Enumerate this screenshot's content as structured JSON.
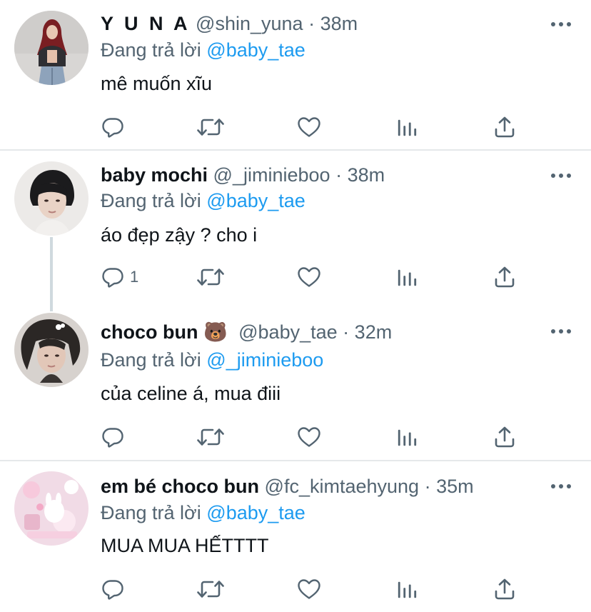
{
  "colors": {
    "accent": "#1d9bf0",
    "muted": "#536471",
    "text": "#0f1419",
    "divider": "#e5e8ea"
  },
  "tweets": [
    {
      "name": "Y U N A",
      "handle": "@shin_yuna",
      "dot": "·",
      "time": "38m",
      "replying_prefix": "Đang trả lời",
      "replying_to": "@baby_tae",
      "text": "mê muốn xĩu",
      "reply_count": ""
    },
    {
      "name": "baby mochi",
      "handle": "@_jiminieboo",
      "dot": "·",
      "time": "38m",
      "replying_prefix": "Đang trả lời",
      "replying_to": "@baby_tae",
      "text": "áo đẹp zậy ? cho i",
      "reply_count": "1"
    },
    {
      "name": "choco bun 🐻",
      "handle": "@baby_tae",
      "dot": "·",
      "time": "32m",
      "replying_prefix": "Đang trả lời",
      "replying_to": "@_jiminieboo",
      "text": "của celine á, mua điii",
      "reply_count": ""
    },
    {
      "name": "em bé choco bun",
      "handle": "@fc_kimtaehyung",
      "dot": "·",
      "time": "35m",
      "replying_prefix": "Đang trả lời",
      "replying_to": "@baby_tae",
      "text": "MUA MUA HẾTTTT",
      "reply_count": ""
    }
  ],
  "icons": {
    "reply": "reply-icon",
    "retweet": "retweet-icon",
    "like": "heart-icon",
    "analytics": "analytics-icon",
    "share": "share-icon",
    "more": "more-icon"
  }
}
